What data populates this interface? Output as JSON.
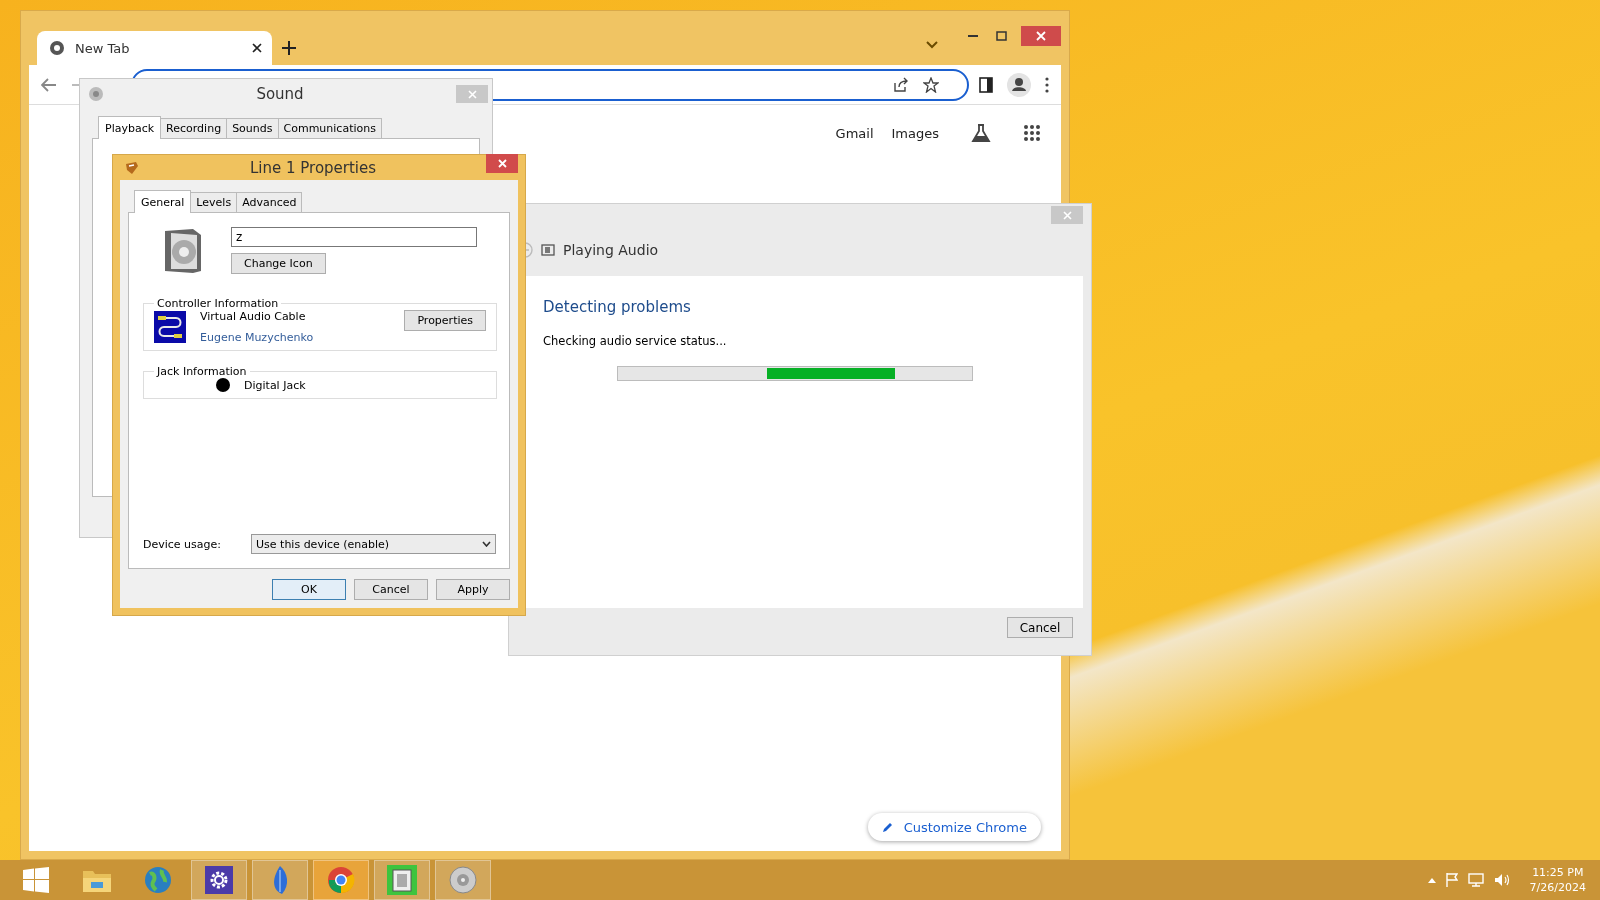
{
  "browser": {
    "tab_title": "New Tab",
    "links": [
      "Gmail",
      "Images"
    ],
    "customize_button": "Customize Chrome"
  },
  "sound_dialog": {
    "title": "Sound",
    "tabs": [
      {
        "label": "Playback",
        "selected": true
      },
      {
        "label": "Recording",
        "selected": false
      },
      {
        "label": "Sounds",
        "selected": false
      },
      {
        "label": "Communications",
        "selected": false
      }
    ]
  },
  "properties_dialog": {
    "title": "Line 1 Properties",
    "tabs": [
      {
        "label": "General",
        "selected": true
      },
      {
        "label": "Levels",
        "selected": false
      },
      {
        "label": "Advanced",
        "selected": false
      }
    ],
    "name_field": {
      "value": "z"
    },
    "change_icon_button": "Change Icon",
    "controller": {
      "heading": "Controller Information",
      "name": "Virtual Audio Cable",
      "vendor": "Eugene Muzychenko",
      "button": "Properties"
    },
    "jack": {
      "heading": "Jack Information",
      "name": "Digital Jack"
    },
    "device_usage": {
      "label": "Device usage:",
      "value": "Use this device (enable)"
    },
    "buttons": [
      "OK",
      "Cancel",
      "Apply"
    ]
  },
  "troubleshooter": {
    "title": "Playing Audio",
    "heading": "Detecting problems",
    "status": "Checking audio service status...",
    "button": "Cancel"
  },
  "taskbar": {
    "time": "11:25 PM",
    "date": "7/26/2024"
  }
}
